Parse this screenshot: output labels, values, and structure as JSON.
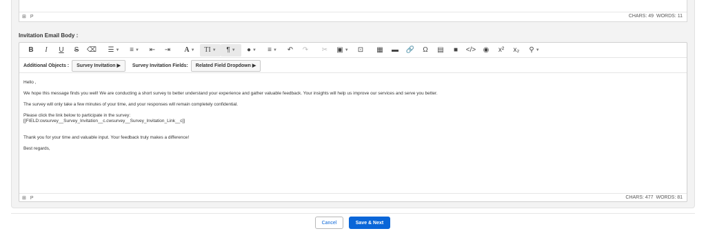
{
  "top_editor": {
    "status_path": "P",
    "chars_label": "CHARS: 49",
    "words_label": "WORDS: 11"
  },
  "email_body": {
    "label": "Invitation Email Body :",
    "toolbar": {
      "bold": "B",
      "italic": "I",
      "underline": "U",
      "strike": "S",
      "font_color": "A",
      "font_size": "TI",
      "paragraph": "¶",
      "superscript": "x²",
      "subscript": "x₂",
      "omega": "Ω"
    },
    "objects": {
      "additional_label": "Additional Objects :",
      "survey_invitation": "Survey Invitation ▶",
      "fields_label": "Survey Invitation Fields:",
      "related_field": "Related Field Dropdown ▶"
    },
    "content": {
      "greeting": "Hello ,",
      "line1": "We hope this message finds you well! We are conducting a short survey to better understand your experience and gather valuable feedback. Your insights will help us improve our services and serve you better.",
      "line2": "The survey will only take a few minutes of your time, and your responses will remain completely confidential.",
      "line3": "Please click the link below to participate in the survey:",
      "line4": "[[FIELD:cwsurvey__Survey_Invitation__c.cwsurvey__Survey_Invitation_Link__c]]",
      "line5": "Thank you for your time and valuable input. Your feedback truly makes a difference!",
      "line6": "Best regards,"
    },
    "status_path": "P",
    "chars_label": "CHARS: 477",
    "words_label": "WORDS: 81"
  },
  "footer": {
    "cancel": "Cancel",
    "save_next": "Save & Next"
  },
  "colors": {
    "primary": "#0a66d8",
    "panel_bg": "#f3f3f3"
  }
}
